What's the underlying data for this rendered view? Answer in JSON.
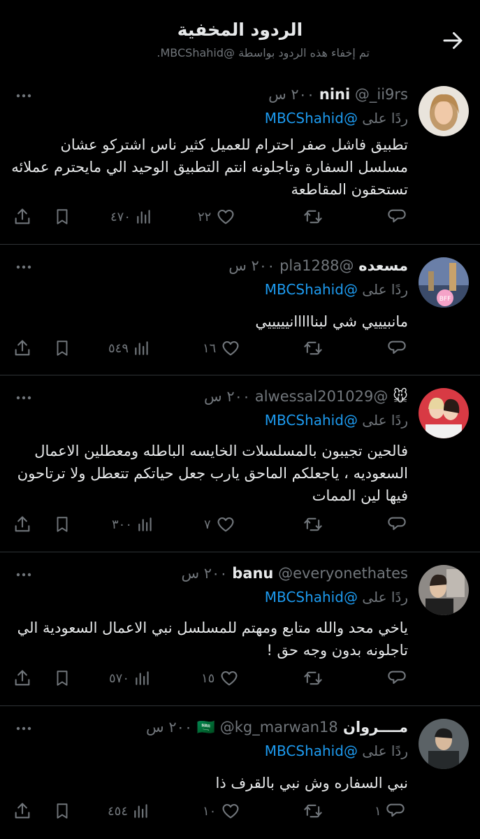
{
  "header": {
    "title": "الردود المخفية",
    "subtitle": "تم إخفاء هذه الردود بواسطة @MBCShahid."
  },
  "reply_prefix": "ردًا على",
  "reply_to": "@MBCShahid",
  "colors": {
    "background": "#000000",
    "text": "#e7e9ea",
    "muted": "#71767b",
    "link": "#1d9bf0",
    "divider": "#2f3336"
  },
  "tweets": [
    {
      "name": "nini",
      "handle": "@_ii9rs",
      "time": "٢٠٠ س",
      "text": "تطبيق فاشل صفر احترام للعميل كثير ناس اشتركو عشان مسلسل السفارة وتاجلونه انتم التطبيق الوحيد الي مايحترم عملائه تستحقون المقاطعة",
      "replies": "",
      "likes": "٢٢",
      "views": "٤٧٠"
    },
    {
      "name": "مسعده",
      "handle": "@pla1288",
      "time": "٢٠٠ س",
      "text": "مانبيييي شي لبنااااانيييييي",
      "replies": "",
      "likes": "١٦",
      "views": "٥٤٩"
    },
    {
      "name": "🐭",
      "handle": "@alwessal201029",
      "time": "٢٠٠ س",
      "text": "فالحين تجيبون بالمسلسلات الخايسه الباطله ومعطلين الاعمال السعوديه ، ياجعلكم الماحق يارب جعل حياتكم تتعطل ولا ترتاحون فيها لين الممات",
      "replies": "",
      "likes": "٧",
      "views": "٣٠٠"
    },
    {
      "name": "banu",
      "handle": "@everyonethates",
      "time": "٢٠٠ س",
      "text": "ياخي محد والله متابع ومهتم للمسلسل نبي الاعمال السعودية الي تاجلونه بدون وجه حق !",
      "replies": "",
      "likes": "١٥",
      "views": "٥٧٠"
    },
    {
      "name": "مــــروان 🇸🇦",
      "handle": "@kg_marwan18",
      "time": "٢٠٠ س",
      "text": "نبي السفاره وش نبي بالقرف ذا",
      "replies": "١",
      "likes": "١٠",
      "views": "٤٥٤"
    }
  ]
}
